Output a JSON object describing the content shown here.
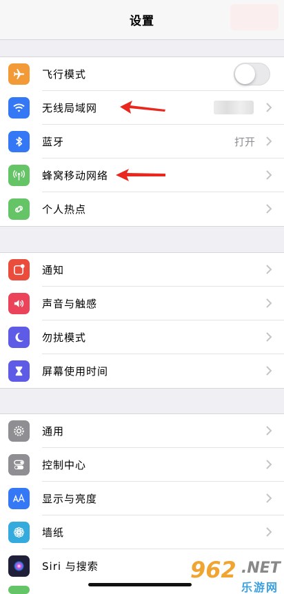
{
  "nav": {
    "title": "设置"
  },
  "groups": [
    {
      "items": [
        {
          "label": "飞行模式",
          "icon": "airplane-icon",
          "color": "#f19a37",
          "control": "toggle",
          "toggle_on": false
        },
        {
          "label": "无线局域网",
          "icon": "wifi-icon",
          "color": "#3478f6",
          "value_blurred": true
        },
        {
          "label": "蓝牙",
          "icon": "bluetooth-icon",
          "color": "#3478f6",
          "value": "打开"
        },
        {
          "label": "蜂窝移动网络",
          "icon": "cellular-icon",
          "color": "#65c466"
        },
        {
          "label": "个人热点",
          "icon": "hotspot-icon",
          "color": "#65c466"
        }
      ]
    },
    {
      "items": [
        {
          "label": "通知",
          "icon": "notifications-icon",
          "color": "#eb4d3d"
        },
        {
          "label": "声音与触感",
          "icon": "sound-icon",
          "color": "#eb445a"
        },
        {
          "label": "勿扰模式",
          "icon": "moon-icon",
          "color": "#5e5ce6"
        },
        {
          "label": "屏幕使用时间",
          "icon": "hourglass-icon",
          "color": "#5e5ce6"
        }
      ]
    },
    {
      "items": [
        {
          "label": "通用",
          "icon": "gear-icon",
          "color": "#8e8e93"
        },
        {
          "label": "控制中心",
          "icon": "switches-icon",
          "color": "#8e8e93"
        },
        {
          "label": "显示与亮度",
          "icon": "text-size-icon",
          "color": "#3478f6"
        },
        {
          "label": "墙纸",
          "icon": "flower-icon",
          "color": "#35aadc"
        },
        {
          "label": "Siri 与搜索",
          "icon": "siri-icon",
          "color": "#1f1f3a"
        }
      ]
    }
  ],
  "annotations": {
    "arrow_color": "#e8281e"
  },
  "watermark": {
    "number": "962",
    "suffix": ".NET",
    "site": "乐游网"
  }
}
